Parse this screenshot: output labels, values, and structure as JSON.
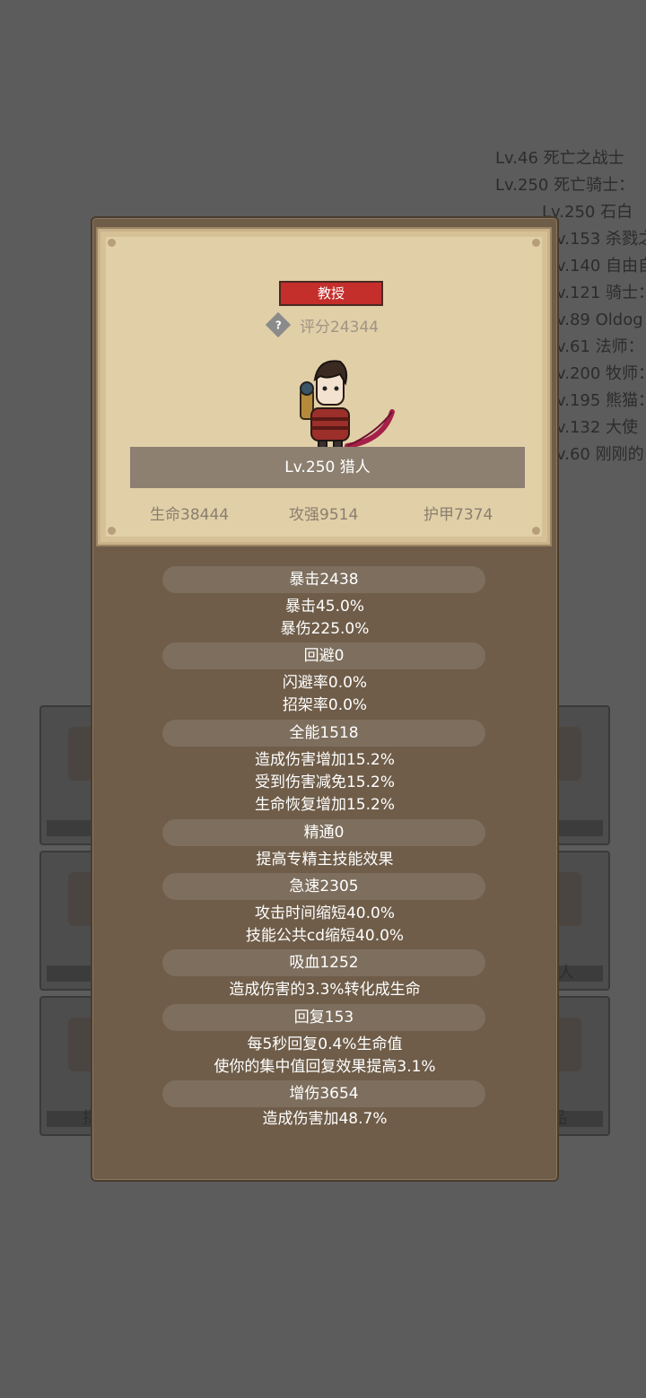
{
  "background_list": [
    "Lv.46 死亡之战士",
    "Lv.250 死亡骑士：",
    "Lv.250 石白",
    "v.153 杀戮之",
    "v.140 自由自",
    "v.121 骑士：",
    "v.89 Oldog：",
    "v.61 法师：",
    "v.200 牧师：",
    "v.195 熊猫：",
    "v.132 大使",
    "v.60 刚刚的"
  ],
  "background_tiles": {
    "left_bottom_glyph": "指",
    "right_middle_glyph": "人",
    "right_bottom_glyph": "品"
  },
  "player": {
    "title_badge": "教授",
    "score_label": "评分24344",
    "name": "Lv.250 猎人",
    "summary": {
      "hp": "生命38444",
      "attack": "攻强9514",
      "armor": "护甲7374"
    }
  },
  "details": {
    "crit": {
      "header": "暴击2438",
      "lines": [
        "暴击45.0%",
        "暴伤225.0%"
      ]
    },
    "dodge": {
      "header": "回避0",
      "lines": [
        "闪避率0.0%",
        "招架率0.0%"
      ]
    },
    "versatility": {
      "header": "全能1518",
      "lines": [
        "造成伤害增加15.2%",
        "受到伤害减免15.2%",
        "生命恢复增加15.2%"
      ]
    },
    "mastery": {
      "header": "精通0",
      "lines": [
        "提高专精主技能效果"
      ]
    },
    "haste": {
      "header": "急速2305",
      "lines": [
        "攻击时间缩短40.0%",
        "技能公共cd缩短40.0%"
      ]
    },
    "leech": {
      "header": "吸血1252",
      "lines": [
        "造成伤害的3.3%转化成生命"
      ]
    },
    "regen": {
      "header": "回复153",
      "lines": [
        "每5秒回复0.4%生命值",
        "使你的集中值回复效果提高3.1%"
      ]
    },
    "damage_up": {
      "header": "增伤3654",
      "lines": [
        "造成伤害加48.7%"
      ]
    }
  },
  "colors": {
    "overlay": "#5c5c5c",
    "panel": "#6f5d49",
    "card": "#e1cfa8",
    "badge": "#c42e2b",
    "pill": "#7d6e5d"
  },
  "icons": [
    "help-icon",
    "hunter-portrait"
  ]
}
